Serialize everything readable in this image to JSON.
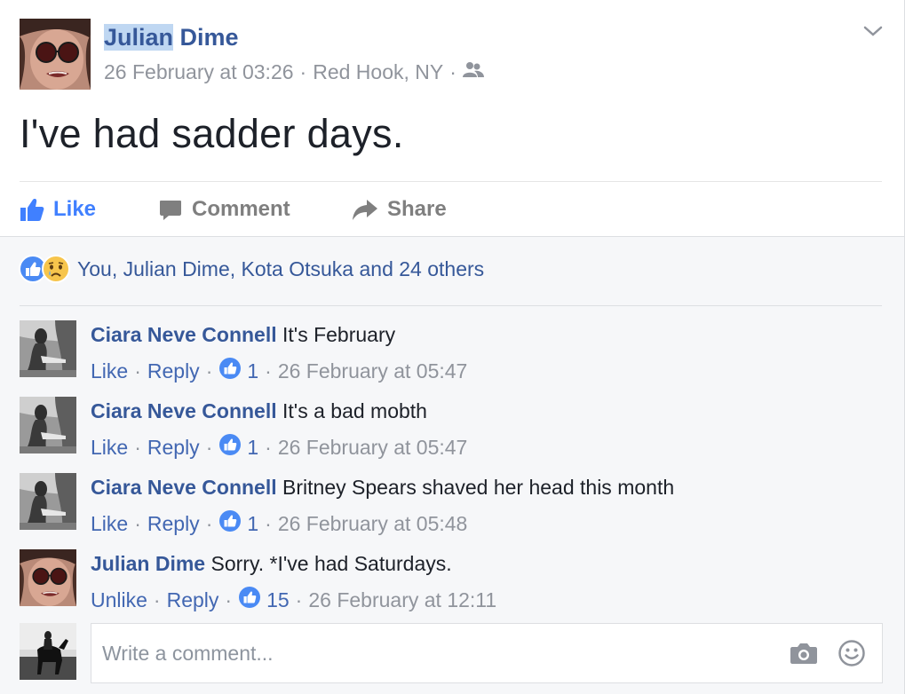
{
  "post": {
    "author_highlight": "Julian",
    "author_rest": " Dime",
    "date": "26 February at 03:26",
    "location": "Red Hook, NY",
    "sep": "·",
    "audience_icon": "friends-icon",
    "text": "I've had sadder days."
  },
  "actions": {
    "like": "Like",
    "comment": "Comment",
    "share": "Share"
  },
  "reactions": {
    "icons": [
      "like-reaction-icon",
      "sad-reaction-icon"
    ],
    "summary": "You, Julian Dime, Kota Otsuka and 24 others"
  },
  "comments": [
    {
      "name": "Ciara Neve Connell",
      "text": "It's February",
      "action": "Like",
      "reply": "Reply",
      "likes": "1",
      "time": "26 February at 05:47"
    },
    {
      "name": "Ciara Neve Connell",
      "text": "It's a bad mobth",
      "action": "Like",
      "reply": "Reply",
      "likes": "1",
      "time": "26 February at 05:47"
    },
    {
      "name": "Ciara Neve Connell",
      "text": "Britney Spears shaved her head this month",
      "action": "Like",
      "reply": "Reply",
      "likes": "1",
      "time": "26 February at 05:48"
    },
    {
      "name": "Julian Dime",
      "text": "Sorry. *I've had Saturdays.",
      "action": "Unlike",
      "reply": "Reply",
      "likes": "15",
      "time": "26 February at 12:11"
    }
  ],
  "compose": {
    "placeholder": "Write a comment...",
    "icons": [
      "camera-icon",
      "smiley-icon"
    ]
  },
  "colors": {
    "link": "#365899",
    "like_blue": "#4080ff",
    "muted": "#90949c",
    "feedback_bg": "#f6f7f9"
  }
}
